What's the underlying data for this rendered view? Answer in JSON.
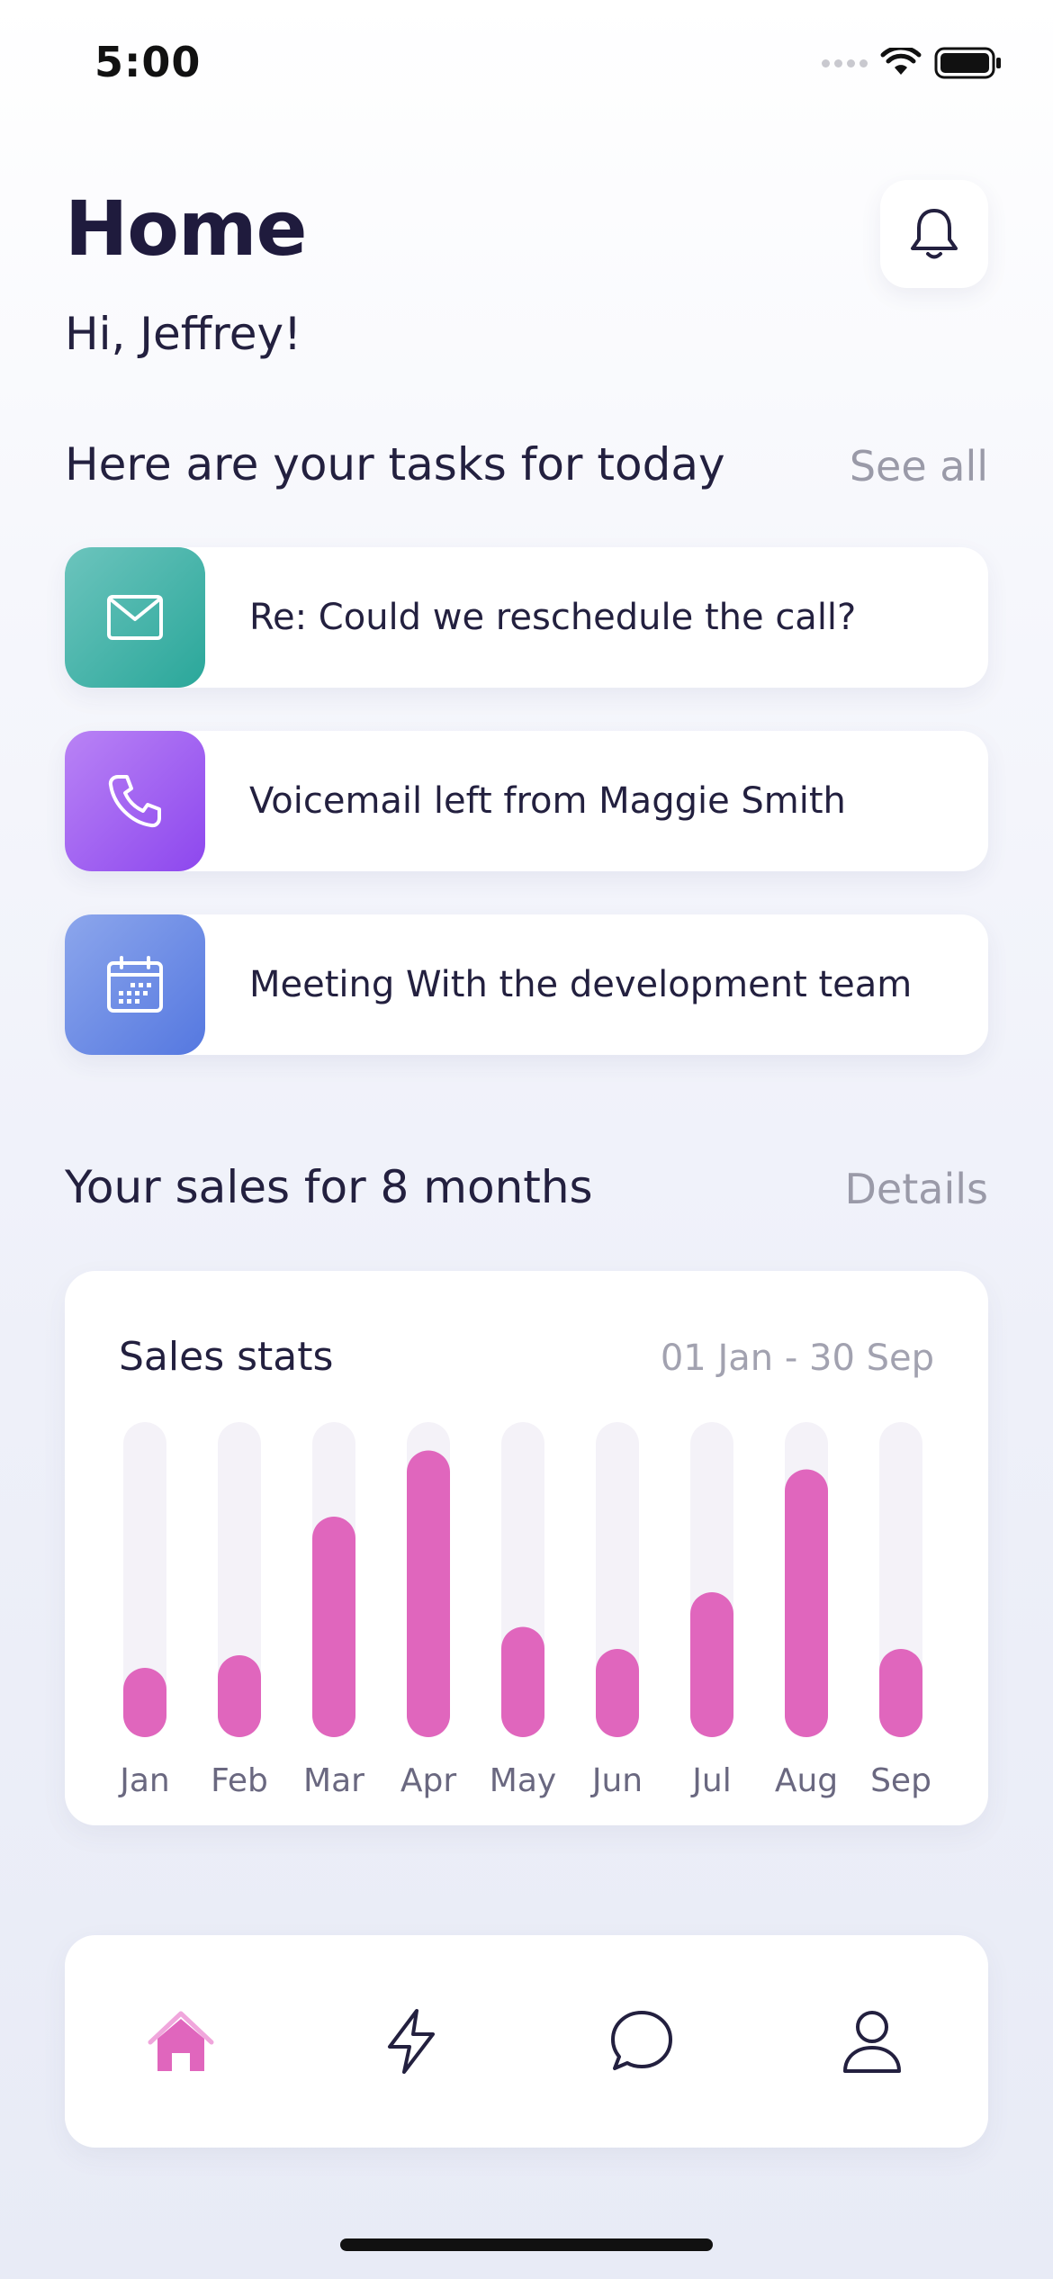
{
  "status_bar": {
    "time": "5:00"
  },
  "header": {
    "title": "Home",
    "greeting": "Hi, Jeffrey!"
  },
  "tasks_section": {
    "title": "Here are your tasks for today",
    "link": "See all",
    "items": [
      {
        "label": "Re: Could we reschedule the call?",
        "icon": "mail-icon"
      },
      {
        "label": "Voicemail left from Maggie Smith",
        "icon": "phone-icon"
      },
      {
        "label": "Meeting With the development team",
        "icon": "calendar-icon"
      }
    ]
  },
  "sales_section": {
    "title": "Your sales for 8 months",
    "link": "Details"
  },
  "chart_card": {
    "title": "Sales stats",
    "range": "01 Jan - 30 Sep"
  },
  "chart_data": {
    "type": "bar",
    "title": "Sales stats",
    "categories": [
      "Jan",
      "Feb",
      "Mar",
      "Apr",
      "May",
      "Jun",
      "Jul",
      "Aug",
      "Sep"
    ],
    "values": [
      22,
      26,
      70,
      91,
      35,
      28,
      46,
      85,
      28
    ],
    "ylim": [
      0,
      100
    ],
    "grid": false,
    "colors": {
      "bar": "#e066bd",
      "track": "#f4f2f8",
      "tick": "#6a6880"
    }
  },
  "bottom_nav": {
    "items": [
      {
        "name": "home",
        "icon": "home-icon",
        "active": true
      },
      {
        "name": "activity",
        "icon": "lightning-icon",
        "active": false
      },
      {
        "name": "messages",
        "icon": "chat-bubble-icon",
        "active": false
      },
      {
        "name": "profile",
        "icon": "user-icon",
        "active": false
      }
    ]
  },
  "colors": {
    "accent": "#e066bd",
    "text": "#23203f",
    "muted": "#9a9aa8"
  }
}
